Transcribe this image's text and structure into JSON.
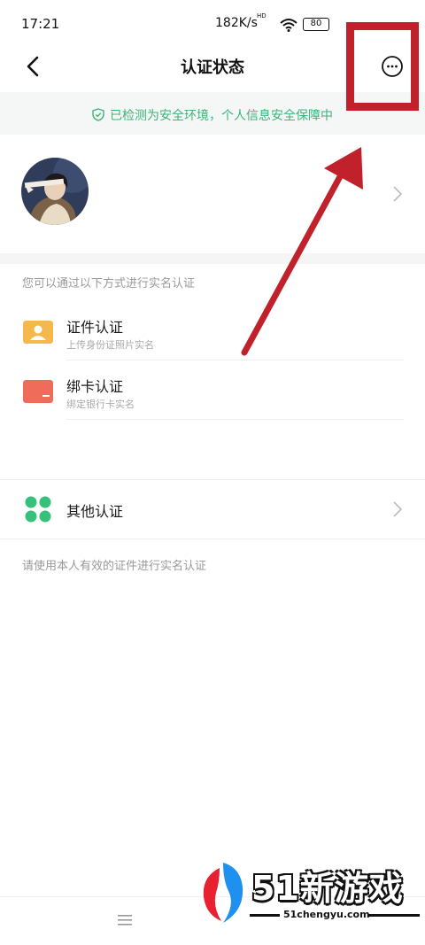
{
  "status_bar": {
    "time": "17:21",
    "network_speed": "182K/s",
    "network_badge": "HD",
    "battery": "80"
  },
  "header": {
    "title": "认证状态"
  },
  "security_banner": {
    "text": "已检测为安全环境，个人信息安全保障中"
  },
  "verification": {
    "hint": "您可以通过以下方式进行实名认证",
    "methods": [
      {
        "title": "证件认证",
        "subtitle": "上传身份证照片实名",
        "icon": "id-card-icon",
        "color": "#f5b84a"
      },
      {
        "title": "绑卡认证",
        "subtitle": "绑定银行卡实名",
        "icon": "bank-card-icon",
        "color": "#ef6b5a"
      }
    ],
    "other": {
      "label": "其他认证",
      "icon": "grid-dots-icon",
      "color": "#35c07c"
    },
    "footer_hint": "请使用本人有效的证件进行实名认证"
  },
  "watermark": {
    "title": "51新游戏",
    "url": "51chengyu.com"
  },
  "colors": {
    "accent_green": "#3fb37a",
    "annotation_red": "#c0212a"
  }
}
